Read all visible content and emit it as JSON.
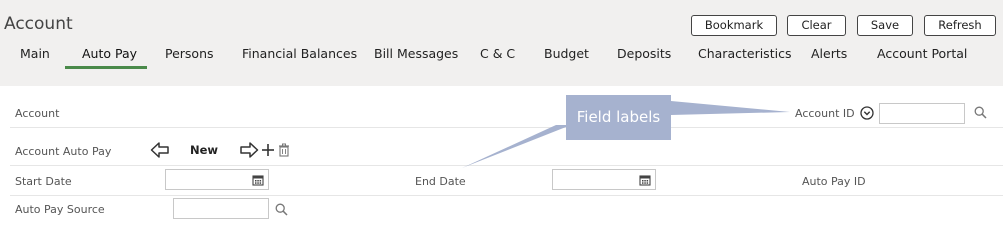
{
  "header": {
    "title": "Account",
    "buttons": {
      "bookmark": "Bookmark",
      "clear": "Clear",
      "save": "Save",
      "refresh": "Refresh"
    }
  },
  "tabs": [
    {
      "label": "Main"
    },
    {
      "label": "Auto Pay",
      "active": true
    },
    {
      "label": "Persons"
    },
    {
      "label": "Financial Balances"
    },
    {
      "label": "Bill Messages"
    },
    {
      "label": "C & C"
    },
    {
      "label": "Budget"
    },
    {
      "label": "Deposits"
    },
    {
      "label": "Characteristics"
    },
    {
      "label": "Alerts"
    },
    {
      "label": "Account Portal"
    }
  ],
  "form": {
    "account_label": "Account",
    "account_id_label": "Account ID",
    "account_id_value": "",
    "account_autopay_label": "Account Auto Pay",
    "new_label": "New",
    "start_date_label": "Start Date",
    "start_date_value": "",
    "end_date_label": "End Date",
    "end_date_value": "",
    "autopay_id_label": "Auto Pay ID",
    "autopay_source_label": "Auto Pay Source",
    "autopay_source_value": ""
  },
  "annotation": {
    "text": "Field labels"
  },
  "colors": {
    "accent": "#4a8a4a",
    "header_bg": "#f1f0ef",
    "callout": "#a6b2cf"
  },
  "icons": [
    "search-icon",
    "calendar-icon",
    "chevron-down-circle-icon",
    "back-arrow-icon",
    "forward-arrow-icon",
    "plus-icon",
    "trash-icon"
  ]
}
